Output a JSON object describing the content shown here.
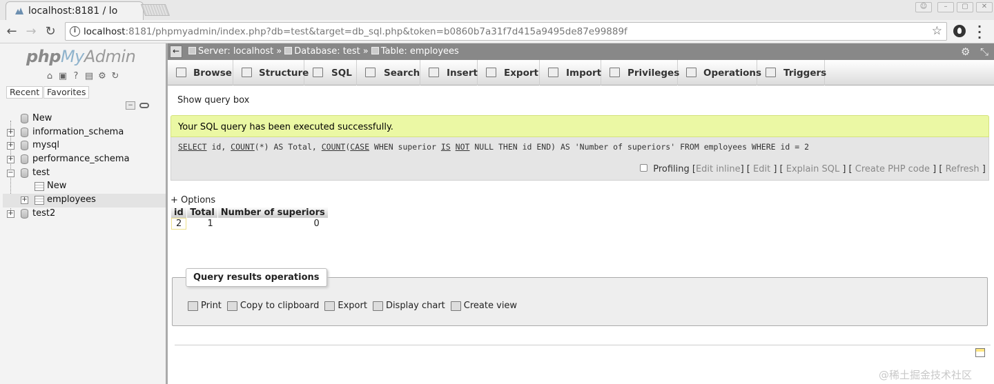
{
  "browser": {
    "tab_title": "localhost:8181 / lo",
    "url_host": "localhost",
    "url_rest": ":8181/phpmyadmin/index.php?db=test&target=db_sql.php&token=b0860b7a31f7d415a9495de87e99889f"
  },
  "nav": {
    "logo": {
      "php": "php",
      "my": "My",
      "admin": "Admin"
    },
    "recent_label": "Recent",
    "favorites_label": "Favorites",
    "tree": [
      {
        "label": "New",
        "type": "new"
      },
      {
        "label": "information_schema",
        "type": "db"
      },
      {
        "label": "mysql",
        "type": "db"
      },
      {
        "label": "performance_schema",
        "type": "db"
      },
      {
        "label": "test",
        "type": "db",
        "expanded": true
      },
      {
        "label": "New",
        "type": "new-child"
      },
      {
        "label": "employees",
        "type": "table",
        "selected": true
      },
      {
        "label": "test2",
        "type": "db"
      }
    ]
  },
  "breadcrumb": {
    "server": "Server: localhost",
    "database": "Database: test",
    "table": "Table: employees",
    "separator": "»"
  },
  "tabs": [
    "Browse",
    "Structure",
    "SQL",
    "Search",
    "Insert",
    "Export",
    "Import",
    "Privileges",
    "Operations",
    "Triggers"
  ],
  "main": {
    "show_query_box": "Show query box",
    "success_message": "Your SQL query has been executed successfully.",
    "sql": {
      "kw_select": "SELECT",
      "part1": " id, ",
      "kw_count1": "COUNT",
      "part2": "(*) AS Total, ",
      "kw_count2": "COUNT",
      "part3": "(",
      "kw_case": "CASE",
      "part4": " WHEN superior ",
      "kw_is": "IS",
      "part5": " ",
      "kw_not": "NOT",
      "part6": " NULL THEN id END) AS 'Number of superiors' FROM employees WHERE id = 2"
    },
    "actions": {
      "profiling": "Profiling",
      "edit_inline": "Edit inline",
      "edit": "Edit",
      "explain": "Explain SQL",
      "create_php": "Create PHP code",
      "refresh": "Refresh"
    },
    "options_link": "+ Options",
    "results": {
      "headers": [
        "id",
        "Total",
        "Number of superiors"
      ],
      "rows": [
        [
          "2",
          "1",
          "0"
        ]
      ]
    },
    "query_ops": {
      "legend": "Query results operations",
      "items": [
        "Print",
        "Copy to clipboard",
        "Export",
        "Display chart",
        "Create view"
      ]
    }
  },
  "watermark": "@稀土掘金技术社区"
}
